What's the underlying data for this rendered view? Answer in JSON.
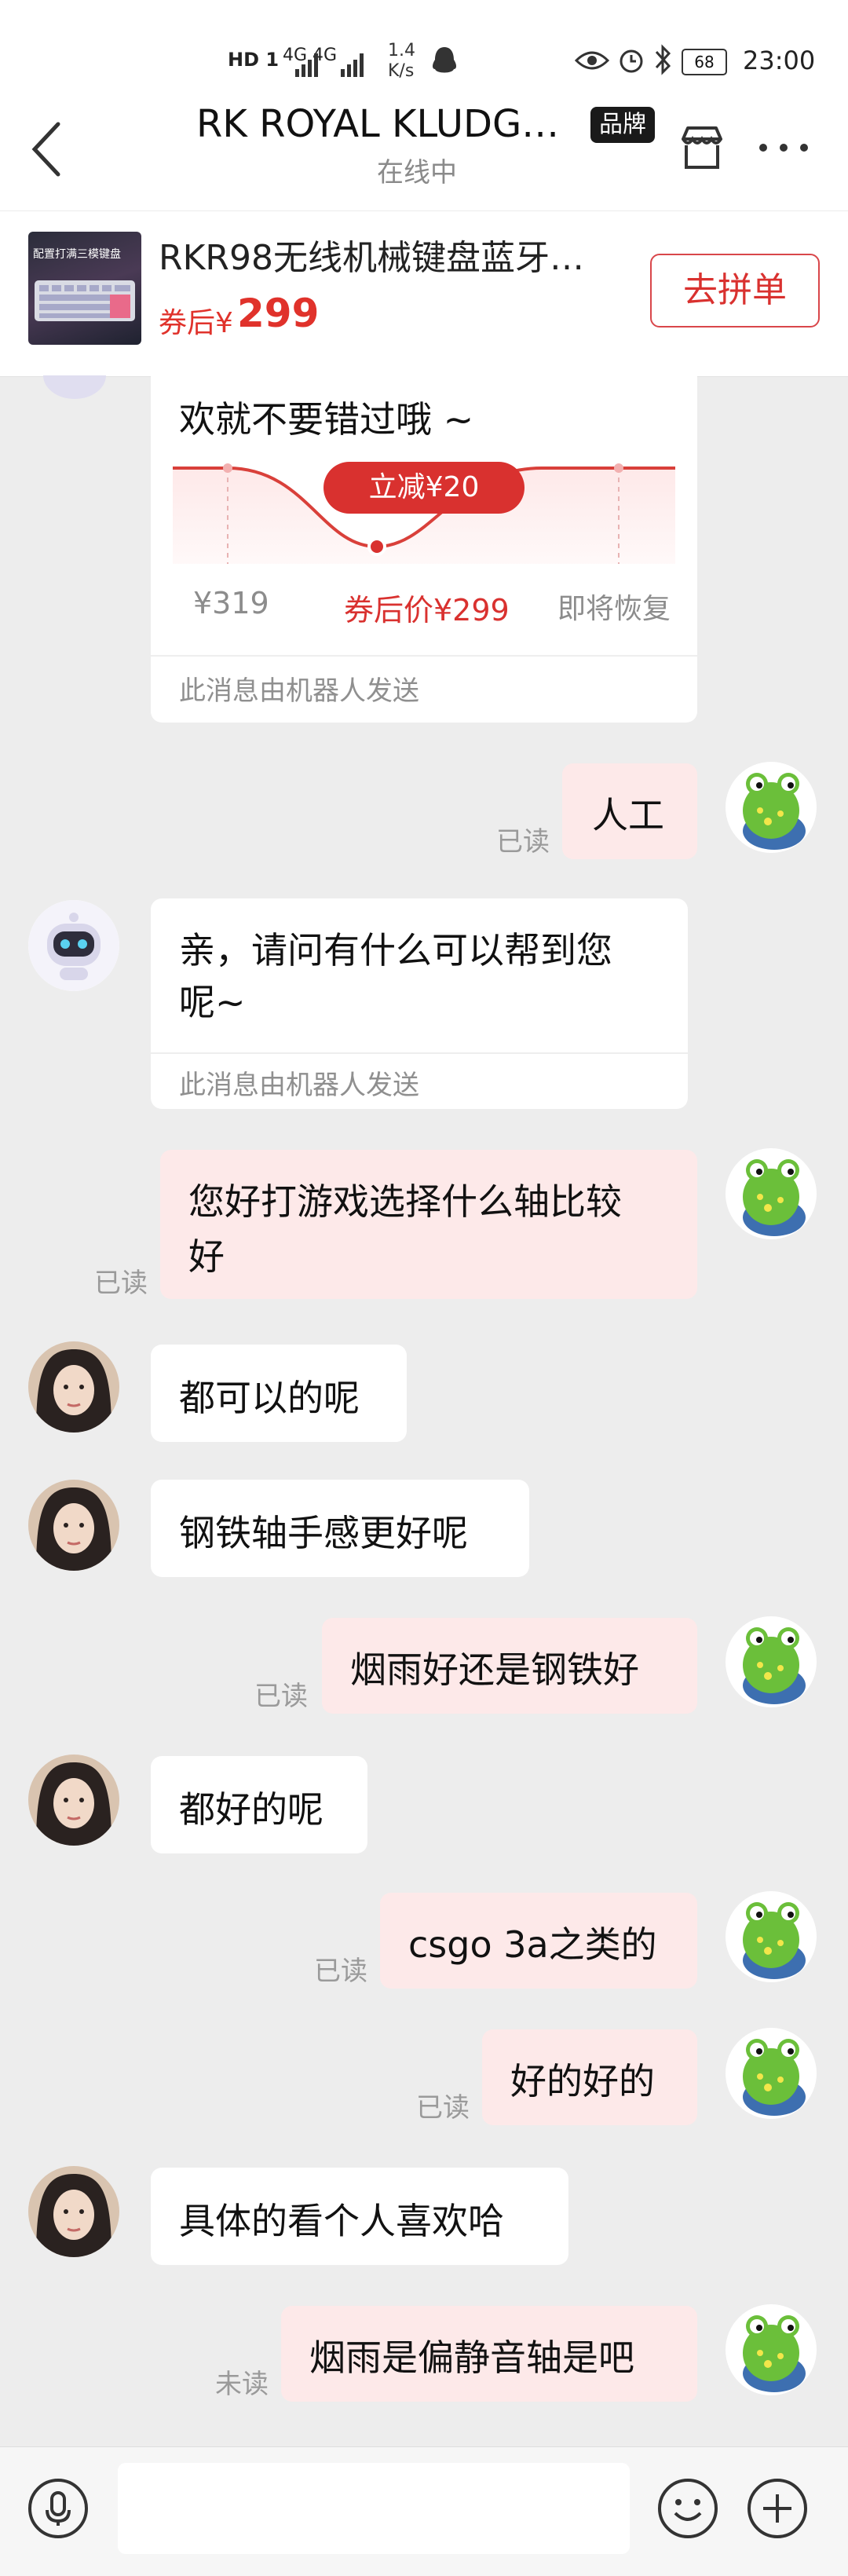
{
  "status_bar": {
    "left_icons": "HD 1",
    "network": "4G 4G",
    "speed": "1.4\nK/s",
    "battery": "68",
    "time": "23:00"
  },
  "header": {
    "title": "RK ROYAL KLUDG…",
    "badge": "品牌",
    "subtitle": "在线中"
  },
  "product": {
    "thumb_caption": "配置打满三模键盘",
    "title": "RKR98无线机械键盘蓝牙…",
    "price_prefix": "券后¥",
    "price": "299",
    "button": "去拼单"
  },
  "coupon_card": {
    "text": "欢就不要错过哦 ~",
    "reduce_label": "立减¥20",
    "orig_price": "¥319",
    "after_price": "券后价¥299",
    "restore_label": "即将恢复",
    "robot_note": "此消息由机器人发送"
  },
  "messages": {
    "m1": {
      "text": "人工",
      "status": "已读"
    },
    "m2": {
      "line1": "亲，请问有什么可以帮到您",
      "line2": "呢~",
      "robot_note": "此消息由机器人发送"
    },
    "m3": {
      "line1": "您好打游戏选择什么轴比较",
      "line2": "好",
      "status": "已读"
    },
    "m4": {
      "text": "都可以的呢"
    },
    "m5": {
      "text": "钢铁轴手感更好呢"
    },
    "m6": {
      "text": "烟雨好还是钢铁好",
      "status": "已读"
    },
    "m7": {
      "text": "都好的呢"
    },
    "m8": {
      "text": "csgo 3a之类的",
      "status": "已读"
    },
    "m9": {
      "text": "好的好的",
      "status": "已读"
    },
    "m10": {
      "text": "具体的看个人喜欢哈"
    },
    "m11": {
      "text": "烟雨是偏静音轴是吧",
      "status": "未读"
    }
  },
  "bottom_bar": {
    "icons": [
      "microphone-icon",
      "emoji-icon",
      "plus-icon"
    ]
  },
  "colors": {
    "accent_red": "#e0322b",
    "self_bubble": "#fde9e9",
    "other_bubble": "#ffffff",
    "background": "#ededed"
  }
}
